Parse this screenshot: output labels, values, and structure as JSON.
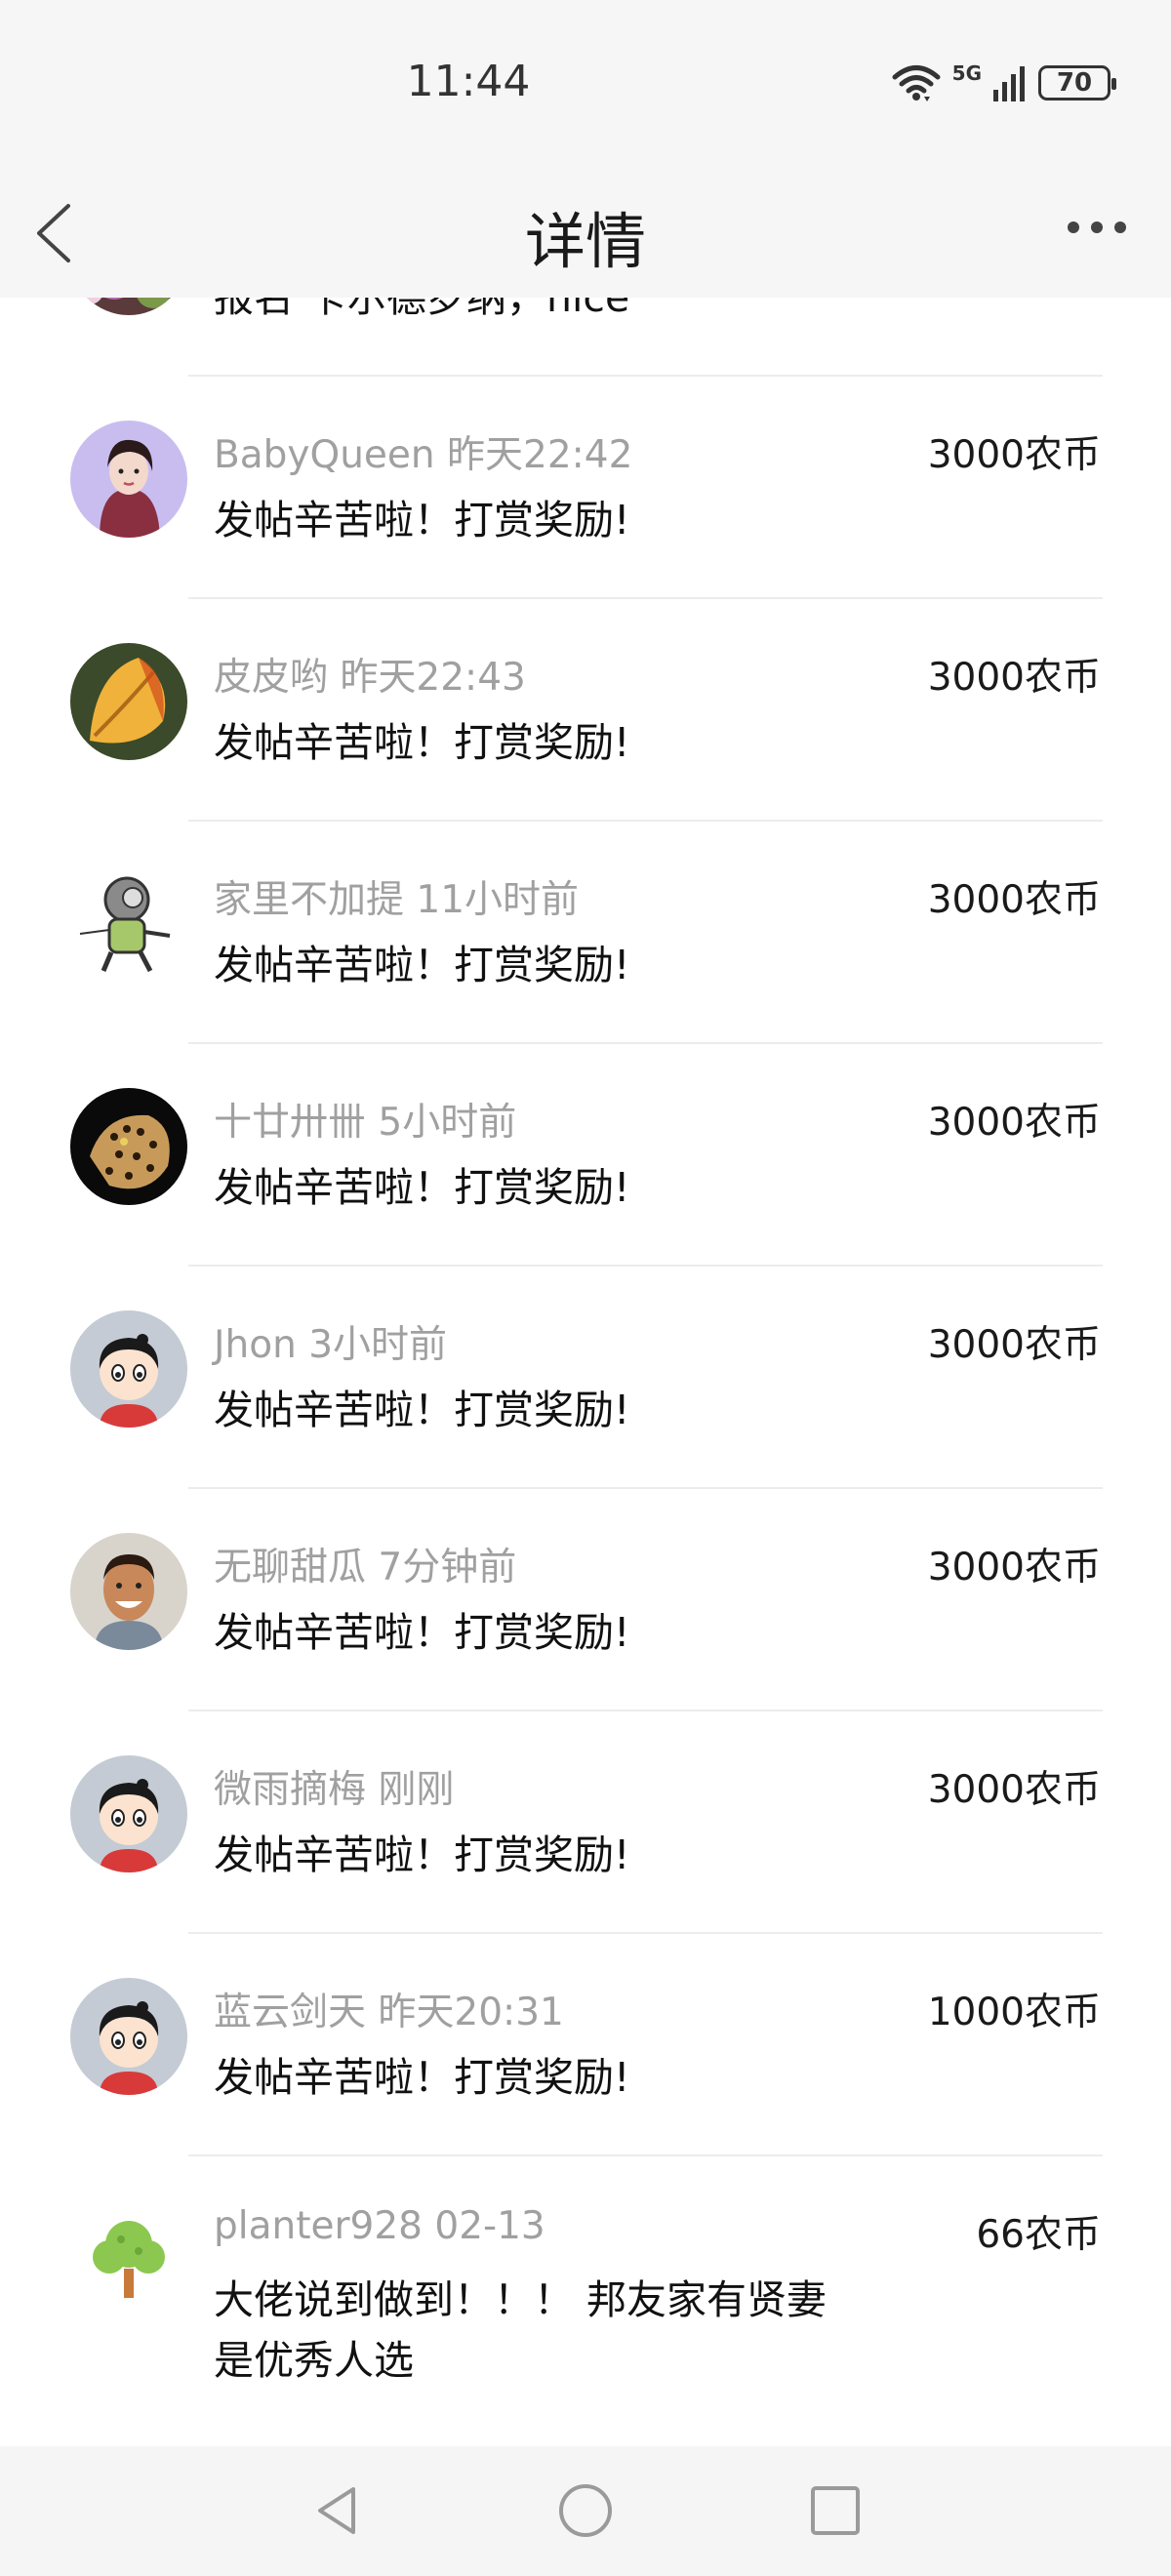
{
  "status_bar": {
    "time": "11:44",
    "network": "5G",
    "battery": "70"
  },
  "header": {
    "title": "详情",
    "back_icon": "chevron-left-icon",
    "more_icon": "more-dots-icon"
  },
  "rewards": [
    {
      "user": "",
      "time": "",
      "amount": "",
      "content": "报名 卡尔德罗纳，nice",
      "avatar_icon": "flowers-avatar"
    },
    {
      "user": "BabyQueen",
      "time": "昨天22:42",
      "amount": "3000农币",
      "content": "发帖辛苦啦！打赏奖励!",
      "avatar_icon": "woman-portrait-avatar"
    },
    {
      "user": "皮皮哟",
      "time": "昨天22:43",
      "amount": "3000农币",
      "content": "发帖辛苦啦！打赏奖励!",
      "avatar_icon": "autumn-leaf-avatar"
    },
    {
      "user": "家里不加提",
      "time": "11小时前",
      "amount": "3000农币",
      "content": "发帖辛苦啦！打赏奖励!",
      "avatar_icon": "astronaut-cartoon-avatar"
    },
    {
      "user": "十廿卅卌",
      "time": "5小时前",
      "amount": "3000农币",
      "content": "发帖辛苦啦！打赏奖励!",
      "avatar_icon": "leopard-avatar"
    },
    {
      "user": "Jhon",
      "time": "3小时前",
      "amount": "3000农币",
      "content": "发帖辛苦啦！打赏奖励!",
      "avatar_icon": "default-cartoon-avatar"
    },
    {
      "user": "无聊甜瓜",
      "time": "7分钟前",
      "amount": "3000农币",
      "content": "发帖辛苦啦！打赏奖励!",
      "avatar_icon": "smiling-man-avatar"
    },
    {
      "user": "微雨摘梅",
      "time": "刚刚",
      "amount": "3000农币",
      "content": "发帖辛苦啦！打赏奖励!",
      "avatar_icon": "default-cartoon-avatar"
    },
    {
      "user": "蓝云剑天",
      "time": "昨天20:31",
      "amount": "1000农币",
      "content": "发帖辛苦啦！打赏奖励!",
      "avatar_icon": "default-cartoon-avatar"
    },
    {
      "user": "planter928",
      "time": "02-13",
      "amount": "66农币",
      "content": "大佬说到做到！！！ 邦友家有贤妻是优秀人选",
      "avatar_icon": "tree-avatar"
    }
  ],
  "nav_bar": {
    "back": "triangle-back-icon",
    "home": "circle-home-icon",
    "recent": "square-recent-icon"
  }
}
